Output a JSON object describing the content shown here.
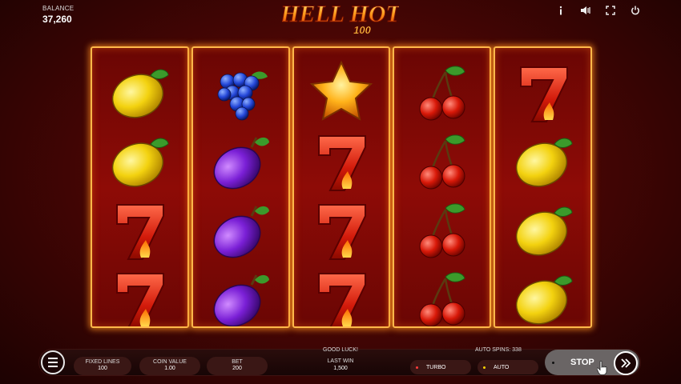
{
  "header": {
    "balance_label": "BALANCE",
    "balance_value": "37,260",
    "logo_text": "HELL HOT",
    "logo_sub": "100",
    "icons": [
      "info-icon",
      "sound-icon",
      "fullscreen-icon",
      "power-icon"
    ]
  },
  "reels": [
    [
      "lemon",
      "lemon",
      "seven",
      "seven"
    ],
    [
      "grapes",
      "plum",
      "plum",
      "plum"
    ],
    [
      "star",
      "seven",
      "seven",
      "seven"
    ],
    [
      "cherry",
      "cherry",
      "cherry",
      "cherry"
    ],
    [
      "seven",
      "lemon",
      "lemon",
      "lemon"
    ]
  ],
  "controls": {
    "fixed_lines_label": "FIXED LINES",
    "fixed_lines_value": "100",
    "coin_value_label": "COIN VALUE",
    "coin_value_value": "1.00",
    "bet_label": "BET",
    "bet_value": "200",
    "status_text": "GOOD LUCK!",
    "last_win_label": "LAST WIN",
    "last_win_value": "1,500",
    "auto_spins_text": "AUTO SPINS: 338",
    "turbo_label": "TURBO",
    "auto_label": "AUTO",
    "stop_label": "STOP"
  },
  "colors": {
    "reel_border": "#ffb84a",
    "turbo_dot": "#ff3b3b",
    "auto_dot": "#ffd400"
  }
}
